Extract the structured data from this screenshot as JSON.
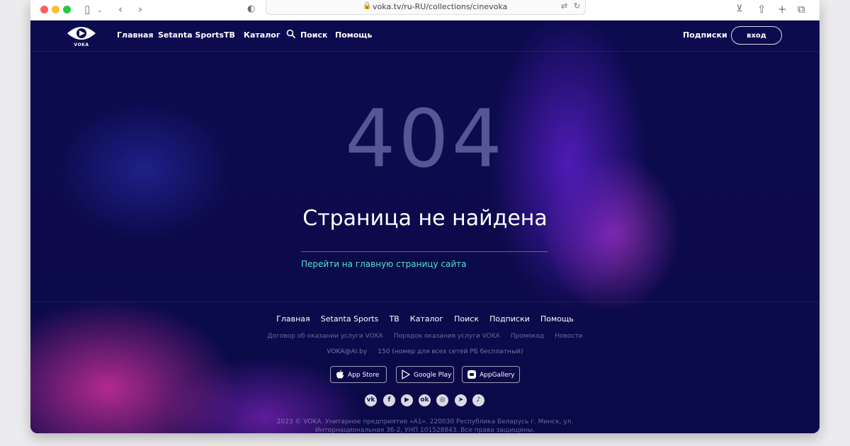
{
  "browser": {
    "url": "voka.tv/ru-RU/collections/cinevoka"
  },
  "nav": {
    "logo_text": "VOKA",
    "links": [
      "Главная",
      "Setanta Sports",
      "ТВ",
      "Каталог",
      "Поиск",
      "Помощь"
    ],
    "subscriptions": "Подписки",
    "login": "вход"
  },
  "error": {
    "code": "404",
    "title": "Страница не найдена",
    "home_link": "Перейти на главную страницу сайта"
  },
  "footer": {
    "nav": [
      "Главная",
      "Setanta Sports",
      "ТВ",
      "Каталог",
      "Поиск",
      "Подписки",
      "Помощь"
    ],
    "docs": [
      "Договор об оказании услуги VOKA",
      "Порядок оказания услуги VOKA",
      "Промокод",
      "Новости"
    ],
    "email": "VOKA@AI.by",
    "phone": "150 (номер для всех сетей РБ бесплатный)",
    "stores": [
      "App Store",
      "Google Play",
      "AppGallery"
    ],
    "socials": [
      "vk-icon",
      "facebook-icon",
      "youtube-icon",
      "odnoklassniki-icon",
      "instagram-icon",
      "telegram-icon",
      "tiktok-icon"
    ],
    "copyright_line1": "2023 © VOKA. Унитарное предприятие «А1». 220030 Республика Беларусь г. Минск, ул.",
    "copyright_line2": "Интернациональная 36-2, УНП 101528843. Все права защищены."
  },
  "colors": {
    "background": "#0c0b4f",
    "accent_link": "#4fe3d0"
  }
}
